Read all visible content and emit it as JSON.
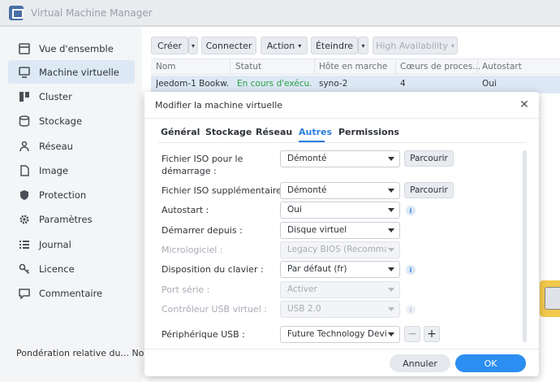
{
  "window": {
    "title": "Virtual Machine Manager"
  },
  "sidebar": {
    "items": [
      {
        "label": "Vue d'ensemble",
        "icon": "overview-icon"
      },
      {
        "label": "Machine virtuelle",
        "icon": "vm-icon",
        "active": true
      },
      {
        "label": "Cluster",
        "icon": "cluster-icon"
      },
      {
        "label": "Stockage",
        "icon": "storage-icon"
      },
      {
        "label": "Réseau",
        "icon": "network-icon"
      },
      {
        "label": "Image",
        "icon": "image-icon"
      },
      {
        "label": "Protection",
        "icon": "shield-icon"
      },
      {
        "label": "Paramètres",
        "icon": "gear-icon"
      },
      {
        "label": "Journal",
        "icon": "list-icon"
      },
      {
        "label": "Licence",
        "icon": "key-icon"
      },
      {
        "label": "Commentaire",
        "icon": "comment-icon"
      }
    ]
  },
  "toolbar": {
    "create": "Créer",
    "connect": "Connecter",
    "action": "Action",
    "shutdown": "Éteindre",
    "high_availability": "High Availability"
  },
  "grid": {
    "headers": [
      "Nom",
      "Statut",
      "Hôte en marche",
      "Cœurs de proces...",
      "Autostart"
    ],
    "row": [
      "Jeedom-1 Bookw...",
      "En cours d'exécu...",
      "syno-2",
      "4",
      "Oui"
    ]
  },
  "background": {
    "bottom_text": "Pondération relative du... Normal"
  },
  "dialog": {
    "title": "Modifier la machine virtuelle",
    "tabs": [
      "Général",
      "Stockage",
      "Réseau",
      "Autres",
      "Permissions"
    ],
    "active_tab": "Autres",
    "fields": [
      {
        "label": "Fichier ISO pour le démarrage :",
        "value": "Démonté",
        "browse": "Parcourir"
      },
      {
        "label": "Fichier ISO supplémentaire :",
        "value": "Démonté",
        "browse": "Parcourir"
      },
      {
        "label": "Autostart :",
        "value": "Oui",
        "info": true
      },
      {
        "label": "Démarrer depuis :",
        "value": "Disque virtuel"
      },
      {
        "label": "Micrologiciel :",
        "value": "Legacy BIOS (Recomman",
        "disabled": true
      },
      {
        "label": "Disposition du clavier :",
        "value": "Par défaut (fr)",
        "info": true
      },
      {
        "label": "Port série :",
        "value": "Activer",
        "disabled": true
      },
      {
        "label": "Contrôleur USB virtuel :",
        "value": "USB 2.0",
        "disabled": true,
        "info": true
      },
      {
        "label": "Périphérique USB :",
        "value": "Future Technology Device",
        "stepper": true
      }
    ],
    "stepper": {
      "minus": "−",
      "plus": "+"
    },
    "cancel": "Annuler",
    "ok": "OK"
  },
  "colors": {
    "accent": "#2b8ef0",
    "selection": "#dde8f5",
    "running_status": "#25a244"
  }
}
